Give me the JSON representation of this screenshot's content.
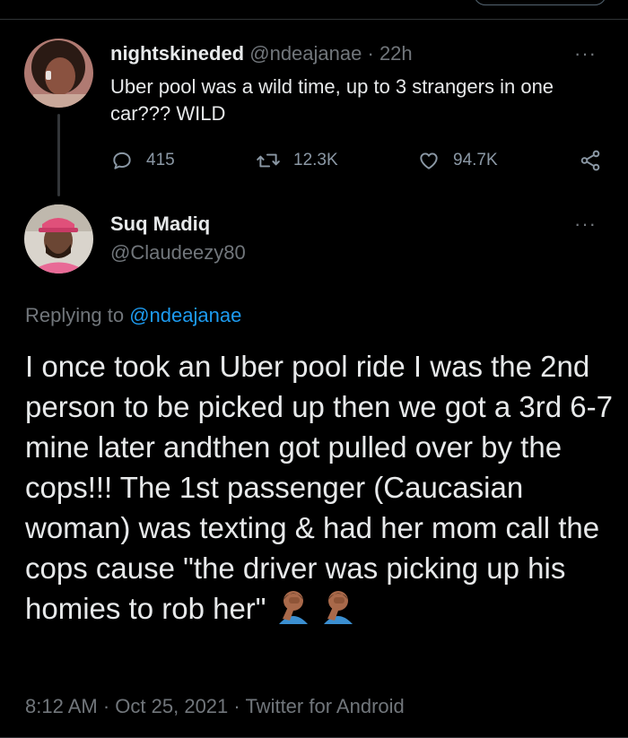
{
  "parent_tweet": {
    "display_name": "nightskineded",
    "handle": "@ndeajanae",
    "separator": "·",
    "time": "22h",
    "text": "Uber pool was a wild time, up to 3 strangers in one car??? WILD",
    "stats": {
      "replies": "415",
      "retweets": "12.3K",
      "likes": "94.7K"
    }
  },
  "main_tweet": {
    "display_name": "Suq Madiq",
    "handle": "@Claudeezy80",
    "replying_prefix": "Replying to",
    "replying_to": "@ndeajanae",
    "text": "I once took an Uber pool ride I was the 2nd person to be picked up then we got a 3rd 6-7 mine later andthen got pulled over by the cops!!! The 1st passenger (Caucasian woman) was texting & had her mom call the cops cause \"the driver was picking up his homies to rob her\"",
    "emojis": [
      "person-facepalming-emoji",
      "person-facepalming-emoji"
    ],
    "time": "8:12 AM",
    "date": "Oct 25, 2021",
    "source": "Twitter for Android",
    "separator": "·"
  },
  "more_label": "···",
  "colors": {
    "background": "#000000",
    "text": "#e7e9ea",
    "muted": "#71767b",
    "link": "#1d9bf0",
    "divider": "#2f3336"
  },
  "icons": {
    "reply": "reply-icon",
    "retweet": "retweet-icon",
    "like": "heart-icon",
    "share": "share-icon",
    "more": "more-icon"
  }
}
